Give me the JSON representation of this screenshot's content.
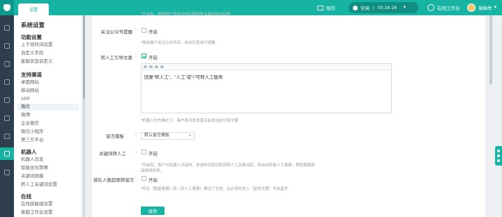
{
  "header": {
    "tab_label": "设置",
    "message_label": "短信",
    "status": {
      "state": "空闲",
      "timer": "00:16:26"
    },
    "online_label": "在线工作台",
    "user_name": "邹梅举"
  },
  "sidebar": {
    "title": "系统设置",
    "groups": [
      {
        "title": "功能设置",
        "items": [
          "上下班时间设置",
          "自定义字段",
          "客服状态自定义"
        ]
      },
      {
        "title": "支持渠道",
        "items": [
          "桌面网站",
          "移动网站",
          "APP",
          "微信",
          "微博",
          "企业微信",
          "微信小程序",
          "第三方平台"
        ]
      },
      {
        "title": "机器人",
        "items": [
          "机器人信息",
          "智能优化策略",
          "关键词屏蔽",
          "转人工关键词设置"
        ]
      },
      {
        "title": "在线",
        "items": [
          "在线技能组设置",
          "客服工作台设置"
        ]
      }
    ],
    "active_item": "微信"
  },
  "form": {
    "top_hint": "*开启后，依据用户消息内容匹配回复关键词自动回复",
    "follow": {
      "label": "关注公众号提醒",
      "checkbox_label": "开启",
      "checked": false,
      "hint": "*微信客户关注公众号后，自动对其进行提醒"
    },
    "transfer": {
      "label": "转人工引导文案",
      "checkbox_label": "开启",
      "checked": true,
      "editor_text": "回复“转人工”、“人工”或“r”可转人工服务",
      "hint": "*机器人优先模式下，客户首次发消息后会发送此引导文案"
    },
    "template": {
      "label": "留言模板",
      "selected": "默认留言模板",
      "arrow": "▾"
    },
    "keyword": {
      "label": "关键词转人工",
      "checkbox_label": "开启",
      "checked": false,
      "hint_line1": "*开启后，客户与机器人对话时，发送的消息匹配到转人工关键词后，将自动转接人工客服，帮助客服提",
      "hint_line2": "高接待效率。"
    },
    "queue": {
      "label": "排队人数超限转留言",
      "checkbox_label": "开启",
      "checked": false,
      "hint": "*仅在［智能客服］和［仅人工客服］模式下生效，且必须先进入［留言设置］开启留言"
    },
    "save_label": "保存"
  },
  "colors": {
    "brand": "#17b3a3",
    "rail": "#2f3e4c",
    "page_bg": "#eef1f4"
  }
}
